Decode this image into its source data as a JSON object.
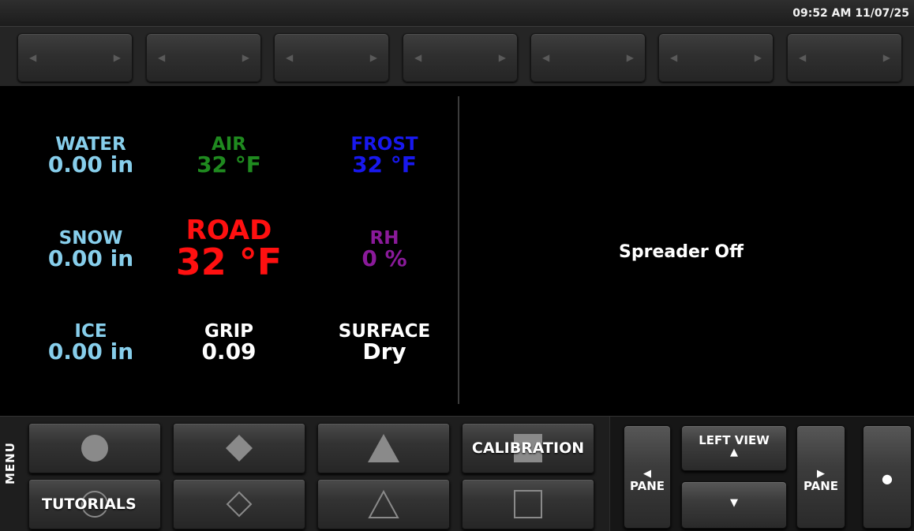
{
  "status": {
    "clock": "09:52 AM 11/07/25"
  },
  "softkeys": [
    {
      "left_icon": "◀",
      "right_icon": "▶"
    },
    {
      "left_icon": "◀",
      "right_icon": "▶"
    },
    {
      "left_icon": "◀",
      "right_icon": "▶"
    },
    {
      "left_icon": "◀",
      "right_icon": "▶"
    },
    {
      "left_icon": "◀",
      "right_icon": "▶"
    },
    {
      "left_icon": "◀",
      "right_icon": "▶"
    },
    {
      "left_icon": "◀",
      "right_icon": "▶"
    }
  ],
  "readings": {
    "water": {
      "label": "WATER",
      "value": "0.00 in",
      "color": "#87ceeb"
    },
    "air": {
      "label": "AIR",
      "value": "32 °F",
      "color": "#1f8a1f"
    },
    "frost": {
      "label": "FROST",
      "value": "32 °F",
      "color": "#1818ee"
    },
    "snow": {
      "label": "SNOW",
      "value": "0.00 in",
      "color": "#87ceeb"
    },
    "road": {
      "label": "ROAD",
      "value": "32 °F",
      "color": "#ff1010"
    },
    "rh": {
      "label": "RH",
      "value": "0 %",
      "color": "#8a1a9a"
    },
    "ice": {
      "label": "ICE",
      "value": "0.00 in",
      "color": "#87ceeb"
    },
    "grip": {
      "label": "GRIP",
      "value": "0.09",
      "color": "#ffffff"
    },
    "surface": {
      "label": "SURFACE",
      "value": "Dry",
      "color": "#ffffff"
    }
  },
  "right_pane": {
    "status": "Spreader Off"
  },
  "bottom": {
    "menu_label": "MENU",
    "function_keys": [
      {
        "icon": "circle-filled"
      },
      {
        "icon": "diamond-filled"
      },
      {
        "icon": "triangle-filled"
      },
      {
        "icon": "square-filled",
        "label": "CALIBRATION"
      },
      {
        "icon": "circle-outline",
        "label": "TUTORIALS"
      },
      {
        "icon": "diamond-outline"
      },
      {
        "icon": "triangle-outline"
      },
      {
        "icon": "square-outline"
      }
    ],
    "nav": {
      "pane_left_label": "PANE",
      "pane_left_icon": "◀",
      "left_view_label": "LEFT VIEW",
      "up_icon": "▲",
      "down_icon": "▼",
      "pane_right_label": "PANE",
      "pane_right_icon": "▶",
      "dot_icon": "●"
    }
  }
}
